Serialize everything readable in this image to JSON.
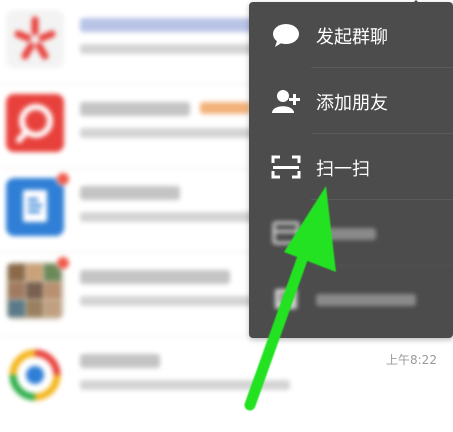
{
  "popup_menu": {
    "items": [
      {
        "label": "发起群聊",
        "icon": "chat-bubble-icon"
      },
      {
        "label": "添加朋友",
        "icon": "add-friend-icon"
      },
      {
        "label": "扫一扫",
        "icon": "scan-icon"
      },
      {
        "label": "",
        "icon": "payment-icon"
      },
      {
        "label": "",
        "icon": "help-icon"
      }
    ]
  },
  "chat_list": {
    "time_label": "上午8:22"
  },
  "colors": {
    "menu_bg": "#4c4c4c",
    "annotation_arrow": "#22e222",
    "badge_red": "#f05a4b"
  }
}
